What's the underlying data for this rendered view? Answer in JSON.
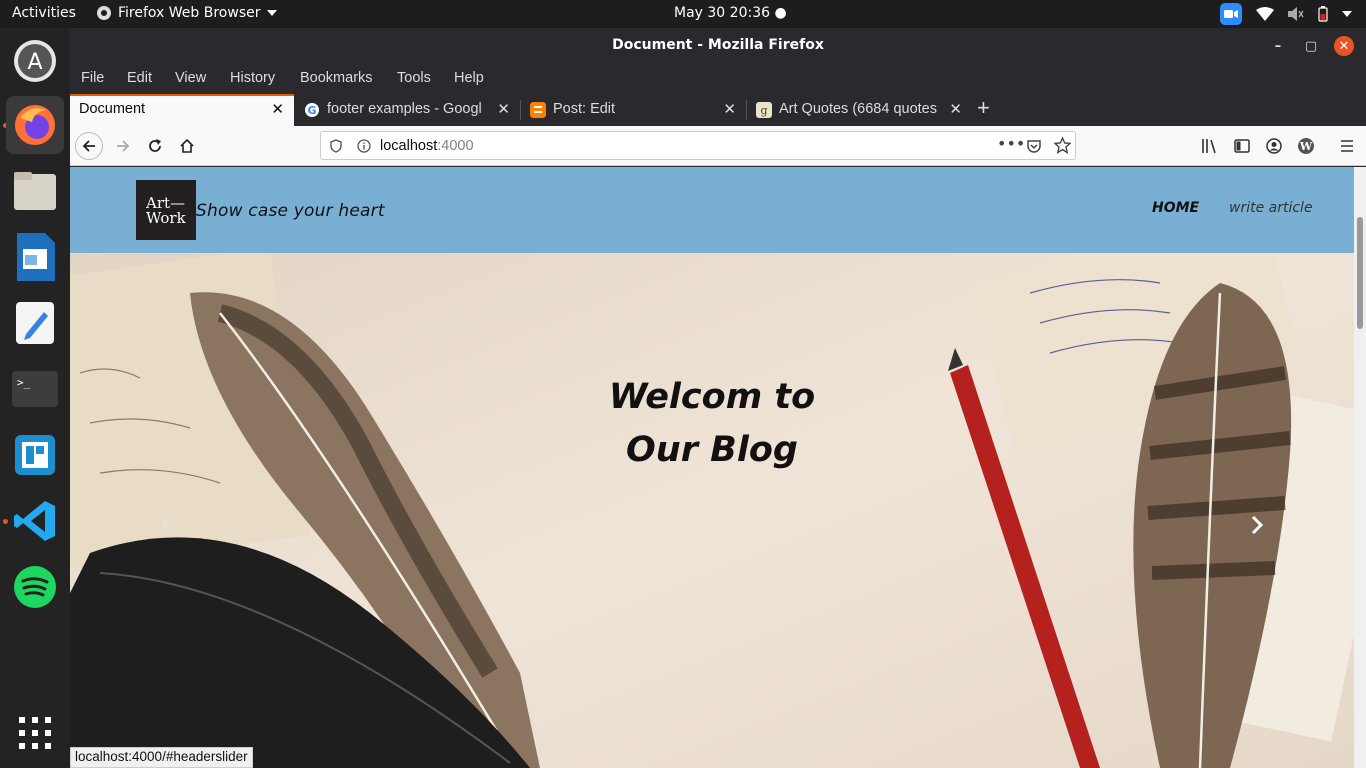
{
  "topbar": {
    "activities": "Activities",
    "app_name": "Firefox Web Browser",
    "clock": "May 30  20:36"
  },
  "window": {
    "title": "Document - Mozilla Firefox"
  },
  "menubar": [
    "File",
    "Edit",
    "View",
    "History",
    "Bookmarks",
    "Tools",
    "Help"
  ],
  "tabs": [
    {
      "label": "Document",
      "active": true
    },
    {
      "label": "footer examples - Googl",
      "active": false
    },
    {
      "label": "Post: Edit",
      "active": false
    },
    {
      "label": "Art Quotes (6684 quotes",
      "active": false
    }
  ],
  "url": {
    "host": "localhost",
    "port": ":4000"
  },
  "site": {
    "logo_line1": "Art—",
    "logo_line2": "Work",
    "tagline": "Show case your heart",
    "nav_home": "HOME",
    "nav_write": "write article",
    "hero_line1": "Welcom to",
    "hero_line2": "Our Blog"
  },
  "status_url": "localhost:4000/#headerslider",
  "colors": {
    "header_bg": "#7aafd4",
    "accent_tab": "#e66000",
    "hero_bg": "#ece0d2"
  }
}
